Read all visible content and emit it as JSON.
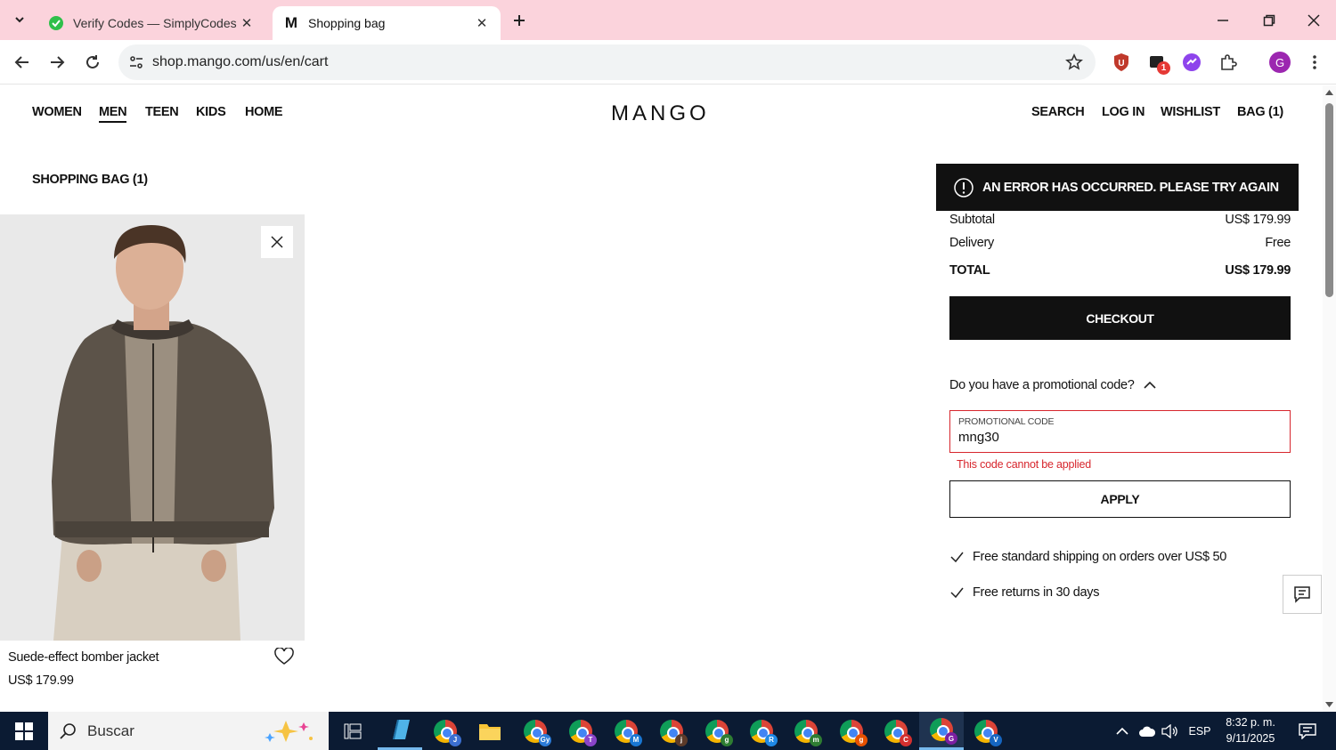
{
  "browser": {
    "tabs": [
      {
        "title": "Verify Codes — SimplyCodes",
        "active": false,
        "favicon": "simplycodes-icon"
      },
      {
        "title": "Shopping bag",
        "active": true,
        "favicon": "mango-m-icon"
      }
    ],
    "url": "shop.mango.com/us/en/cart",
    "profile_initial": "G",
    "extension_badge": "1"
  },
  "site": {
    "logo": "MANGO",
    "nav_left": [
      "WOMEN",
      "MEN",
      "TEEN",
      "KIDS",
      "HOME"
    ],
    "nav_active": "MEN",
    "nav_right": [
      "SEARCH",
      "LOG IN",
      "WISHLIST",
      "BAG (1)"
    ]
  },
  "bag": {
    "title": "SHOPPING BAG (1)",
    "item": {
      "name": "Suede-effect bomber jacket",
      "price": "US$ 179.99"
    }
  },
  "summary": {
    "error": "AN ERROR HAS OCCURRED. PLEASE TRY AGAIN",
    "subtotal_label": "Subtotal",
    "subtotal_value": "US$ 179.99",
    "delivery_label": "Delivery",
    "delivery_value": "Free",
    "total_label": "TOTAL",
    "total_value": "US$ 179.99",
    "checkout_label": "CHECKOUT",
    "promo_question": "Do you have a promotional code?",
    "promo_field_label": "PROMOTIONAL CODE",
    "promo_value": "mng30",
    "promo_error": "This code cannot be applied",
    "apply_label": "APPLY",
    "perks": [
      "Free standard shipping on orders over US$ 50",
      "Free returns in 30 days"
    ]
  },
  "taskbar": {
    "search_placeholder": "Buscar",
    "chrome_profiles": [
      {
        "letter": "J",
        "color": "#3b6fd1"
      },
      {
        "letter": "Gy",
        "color": "#2b7bd8"
      },
      {
        "letter": "T",
        "color": "#8a44c9"
      },
      {
        "letter": "M",
        "color": "#1976d2"
      },
      {
        "letter": "j",
        "color": "#5b3a29"
      },
      {
        "letter": "g",
        "color": "#2e7d32"
      },
      {
        "letter": "R",
        "color": "#1e88e5"
      },
      {
        "letter": "m",
        "color": "#2e7d32"
      },
      {
        "letter": "g",
        "color": "#e65100"
      },
      {
        "letter": "C",
        "color": "#d32f2f"
      },
      {
        "letter": "G",
        "color": "#7b1fa2"
      },
      {
        "letter": "V",
        "color": "#1565c0"
      }
    ],
    "language": "ESP",
    "time": "8:32 p. m.",
    "date": "9/11/2025"
  }
}
